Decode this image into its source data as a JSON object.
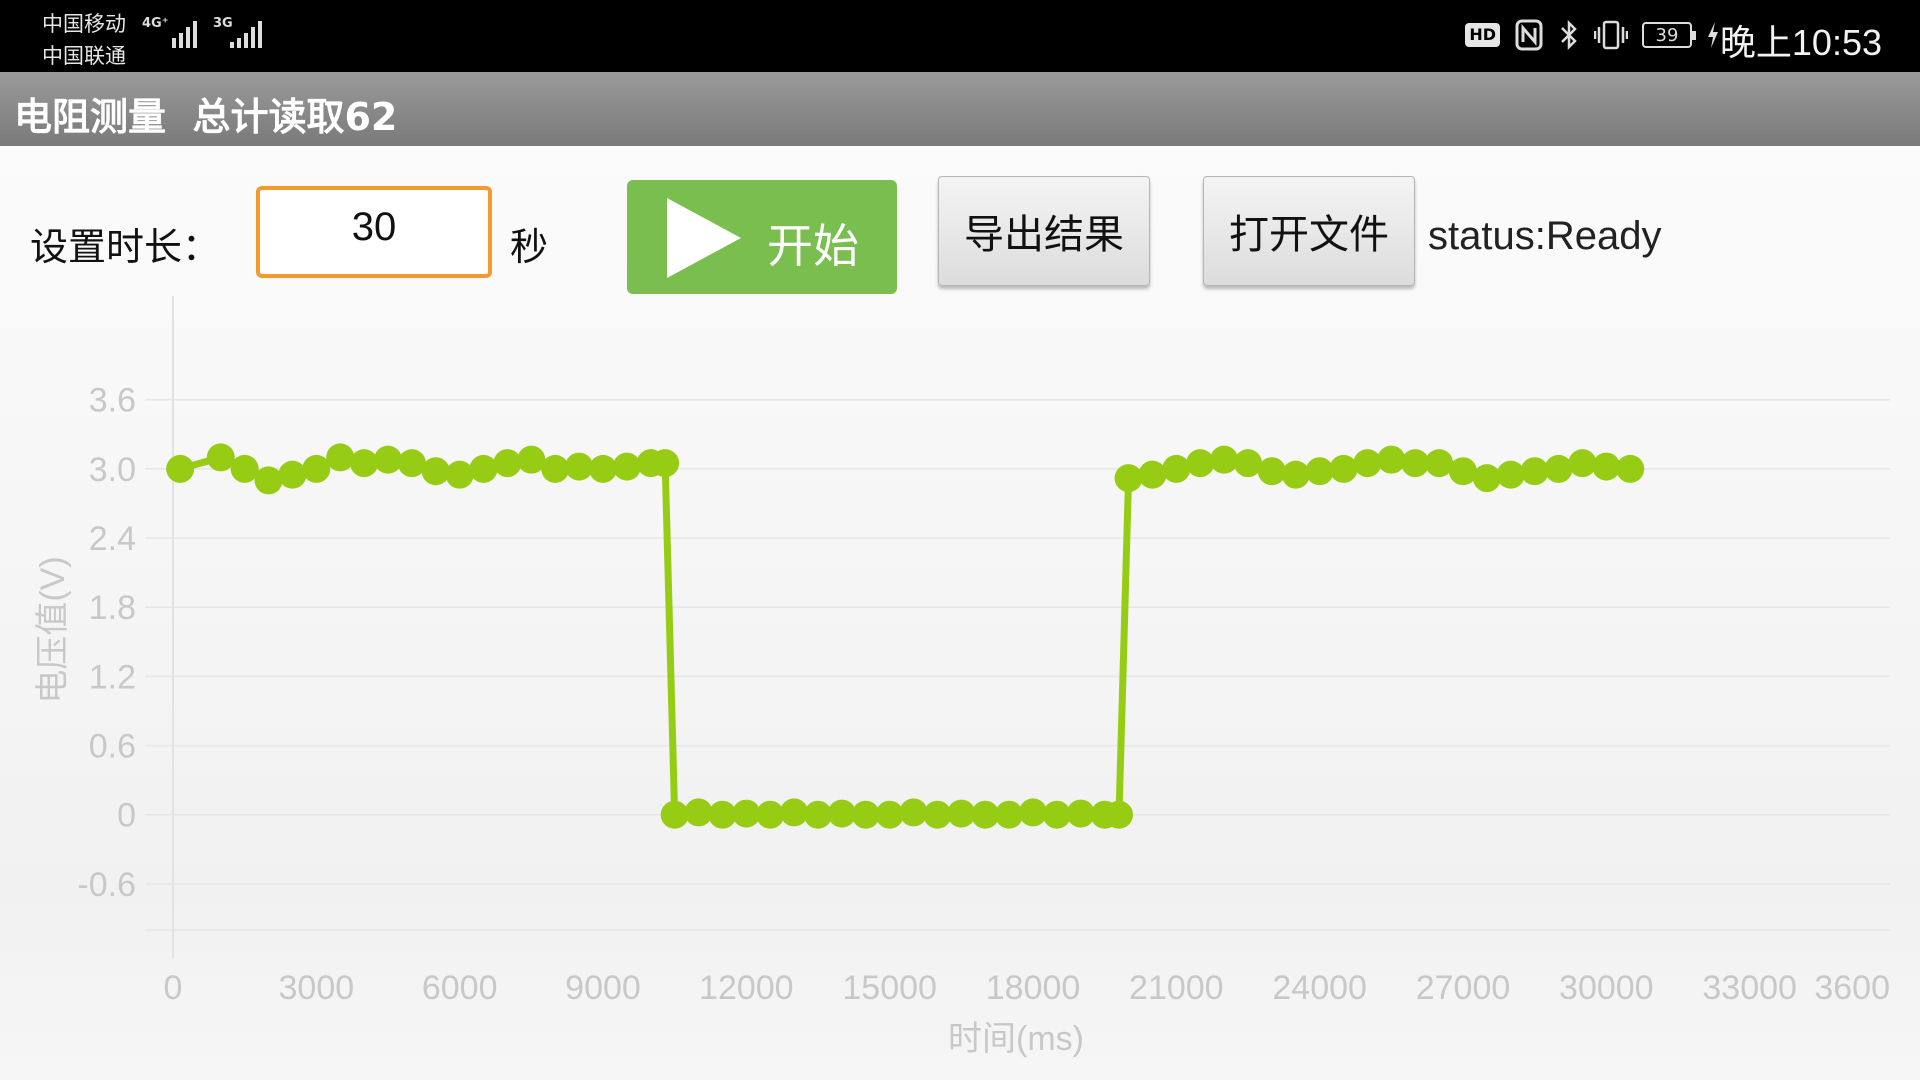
{
  "status_bar": {
    "carrier_1": "中国移动",
    "carrier_2": "中国联通",
    "net_1": "4G⁺",
    "net_2": "3G",
    "hd_badge": "HD",
    "battery": "39",
    "clock": "晚上10:53",
    "icons": [
      "nfc-icon",
      "bluetooth-icon",
      "vibrate-icon",
      "battery-icon",
      "charging-icon"
    ]
  },
  "app": {
    "title": "电阻测量  总计读取62"
  },
  "controls": {
    "duration_label": "设置时长：",
    "duration_value": "30",
    "seconds_label": "秒",
    "start_label": "开始",
    "export_label": "导出结果",
    "open_file_label": "打开文件",
    "status": "status:Ready"
  },
  "colors": {
    "series": "#97cc14",
    "start_button": "#79be4f",
    "input_border": "#f39a2f"
  },
  "chart_data": {
    "type": "line",
    "xlabel": "时间(ms)",
    "ylabel": "电压值(V)",
    "x_ticks": [
      "0",
      "3000",
      "6000",
      "9000",
      "12000",
      "15000",
      "18000",
      "21000",
      "24000",
      "27000",
      "30000",
      "33000",
      "3600"
    ],
    "y_ticks": [
      "3.6",
      "3.0",
      "2.4",
      "1.8",
      "1.2",
      "0.6",
      "0",
      "-0.6"
    ],
    "xlim": [
      0,
      36000
    ],
    "ylim": [
      -1.0,
      4.5
    ],
    "grid": true,
    "series": [
      {
        "x": [
          150,
          1000,
          1500,
          2000,
          2500,
          3000,
          3500,
          4000,
          4500,
          5000,
          5500,
          6000,
          6500,
          7000,
          7500,
          8000,
          8500,
          9000,
          9500,
          10000,
          10300,
          10500,
          11000,
          11500,
          12000,
          12500,
          13000,
          13500,
          14000,
          14500,
          15000,
          15500,
          16000,
          16500,
          17000,
          17500,
          18000,
          18500,
          19000,
          19500,
          19800,
          20000,
          20500,
          21000,
          21500,
          22000,
          22500,
          23000,
          23500,
          24000,
          24500,
          25000,
          25500,
          26000,
          26500,
          27000,
          27500,
          28000,
          28500,
          29000,
          29500,
          30000,
          30500
        ],
        "y": [
          3.0,
          3.1,
          3.0,
          2.9,
          2.95,
          3.0,
          3.1,
          3.05,
          3.08,
          3.05,
          2.98,
          2.95,
          3.0,
          3.05,
          3.08,
          3.0,
          3.02,
          3.0,
          3.02,
          3.05,
          3.05,
          0.0,
          0.02,
          0.0,
          0.01,
          0.0,
          0.02,
          0.0,
          0.01,
          0.0,
          0.0,
          0.02,
          0.0,
          0.01,
          0.0,
          0.0,
          0.02,
          0.0,
          0.01,
          0.0,
          0.0,
          2.92,
          2.95,
          3.0,
          3.05,
          3.08,
          3.05,
          2.98,
          2.95,
          2.98,
          3.0,
          3.05,
          3.08,
          3.05,
          3.05,
          2.98,
          2.92,
          2.95,
          2.98,
          3.0,
          3.05,
          3.02,
          3.0
        ]
      }
    ]
  }
}
